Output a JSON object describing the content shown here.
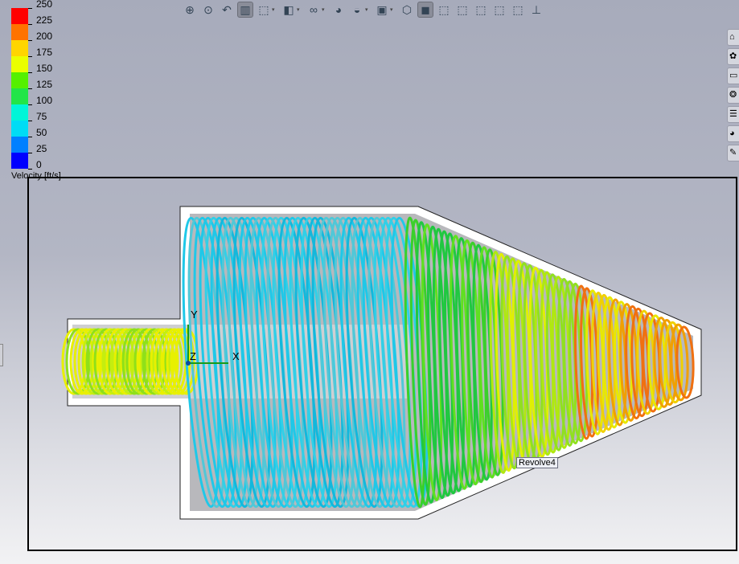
{
  "toolbar": {
    "buttons": [
      {
        "name": "zoom-to-fit-icon",
        "glyph": "⊕"
      },
      {
        "name": "zoom-to-area-icon",
        "glyph": "⊙"
      },
      {
        "name": "previous-view-icon",
        "glyph": "↶"
      },
      {
        "name": "section-view-icon",
        "glyph": "▥",
        "active": true
      },
      {
        "name": "view-orientation-icon",
        "glyph": "⬚",
        "dropdown": true
      },
      {
        "name": "display-style-icon",
        "glyph": "◧",
        "dropdown": true
      },
      {
        "name": "hide-show-items-icon",
        "glyph": "∞",
        "dropdown": true
      },
      {
        "name": "edit-appearance-icon",
        "glyph": "◕"
      },
      {
        "name": "apply-scene-icon",
        "glyph": "◒",
        "dropdown": true
      },
      {
        "name": "view-settings-icon",
        "glyph": "▣",
        "dropdown": true
      },
      {
        "name": "isometric-view-icon",
        "glyph": "⬡"
      },
      {
        "name": "shaded-view-icon",
        "glyph": "◼",
        "active": true
      },
      {
        "name": "wireframe-view-1-icon",
        "glyph": "⬚"
      },
      {
        "name": "wireframe-view-2-icon",
        "glyph": "⬚"
      },
      {
        "name": "wireframe-view-3-icon",
        "glyph": "⬚"
      },
      {
        "name": "wireframe-view-4-icon",
        "glyph": "⬚"
      },
      {
        "name": "wireframe-view-5-icon",
        "glyph": "⬚"
      },
      {
        "name": "normal-to-icon",
        "glyph": "⊥"
      }
    ]
  },
  "legend": {
    "title": "Velocity [ft/s]",
    "labels": [
      "250",
      "225",
      "200",
      "175",
      "150",
      "125",
      "100",
      "75",
      "50",
      "25",
      "0"
    ],
    "colors": [
      "#ff0000",
      "#ff7300",
      "#ffd500",
      "#eaff00",
      "#55f000",
      "#22e548",
      "#00f5d8",
      "#00dcf5",
      "#0080ff",
      "#0000ff"
    ]
  },
  "right_panel": [
    {
      "name": "home-icon",
      "glyph": "⌂"
    },
    {
      "name": "resources-icon",
      "glyph": "✿"
    },
    {
      "name": "folder-icon",
      "glyph": "▭"
    },
    {
      "name": "toolbox-icon",
      "glyph": "❂"
    },
    {
      "name": "properties-icon",
      "glyph": "☰"
    },
    {
      "name": "appearances-icon",
      "glyph": "◕"
    },
    {
      "name": "custom-properties-icon",
      "glyph": "✎"
    }
  ],
  "triad": {
    "x": "X",
    "y": "Y",
    "z": "Z"
  },
  "tooltip": "Revolve4"
}
